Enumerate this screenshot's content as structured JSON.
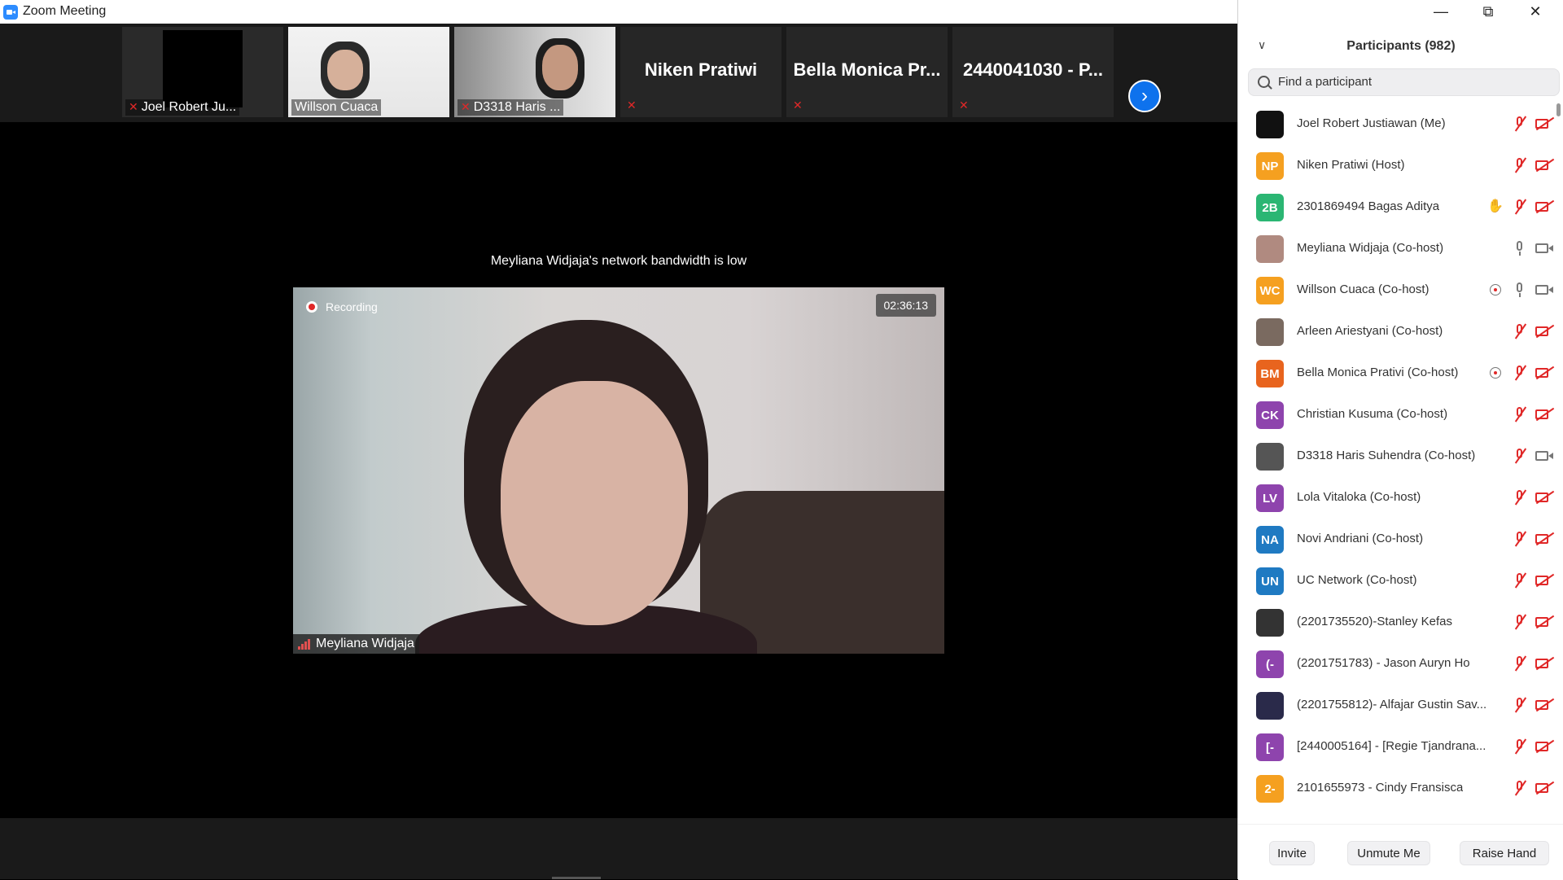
{
  "window": {
    "title": "Zoom Meeting"
  },
  "gallery": {
    "tiles": [
      {
        "name": "Joel Robert Ju...",
        "type": "video",
        "muted": true
      },
      {
        "name": "Willson Cuaca",
        "type": "video",
        "muted": false
      },
      {
        "name": "D3318 Haris ...",
        "type": "video",
        "muted": true
      },
      {
        "name": "Niken Pratiwi",
        "type": "name-only",
        "muted": true
      },
      {
        "name": "Bella Monica Pr...",
        "type": "name-only",
        "muted": true
      },
      {
        "name": "2440041030 - P...",
        "type": "name-only",
        "muted": true
      }
    ],
    "next_icon": "chevron-right-icon"
  },
  "main": {
    "notice": "Meyliana Widjaja's network bandwidth is low",
    "recording_label": "Recording",
    "timer": "02:36:13",
    "speaker_name": "Meyliana Widjaja"
  },
  "participants": {
    "title": "Participants (982)",
    "search_placeholder": "Find a participant",
    "list": [
      {
        "name": "Joel Robert Justiawan (Me)",
        "initials": "",
        "color": "#111111",
        "icons": [
          "mic-off",
          "cam-off"
        ]
      },
      {
        "name": "Niken Pratiwi (Host)",
        "initials": "NP",
        "color": "#f5a020",
        "icons": [
          "mic-off",
          "cam-off"
        ]
      },
      {
        "name": "2301869494 Bagas Aditya",
        "initials": "2B",
        "color": "#2bb673",
        "icons": [
          "hand",
          "mic-off",
          "cam-off"
        ]
      },
      {
        "name": "Meyliana Widjaja (Co-host)",
        "initials": "",
        "color": "#b08a80",
        "icons": [
          "mic-on",
          "cam-on"
        ]
      },
      {
        "name": "Willson Cuaca (Co-host)",
        "initials": "WC",
        "color": "#f5a020",
        "icons": [
          "rec-on",
          "mic-on",
          "cam-on"
        ]
      },
      {
        "name": "Arleen Ariestyani (Co-host)",
        "initials": "",
        "color": "#7a6a60",
        "icons": [
          "mic-off",
          "cam-off"
        ]
      },
      {
        "name": "Bella Monica Prativi (Co-host)",
        "initials": "BM",
        "color": "#e8641e",
        "icons": [
          "rec-on",
          "mic-off",
          "cam-off"
        ]
      },
      {
        "name": "Christian Kusuma (Co-host)",
        "initials": "CK",
        "color": "#8e44ad",
        "icons": [
          "mic-off",
          "cam-off"
        ]
      },
      {
        "name": "D3318 Haris Suhendra (Co-host)",
        "initials": "",
        "color": "#555555",
        "icons": [
          "mic-off",
          "cam-on"
        ]
      },
      {
        "name": "Lola Vitaloka (Co-host)",
        "initials": "LV",
        "color": "#8e44ad",
        "icons": [
          "mic-off",
          "cam-off"
        ]
      },
      {
        "name": "Novi Andriani (Co-host)",
        "initials": "NA",
        "color": "#1f7ac2",
        "icons": [
          "mic-off",
          "cam-off"
        ]
      },
      {
        "name": "UC Network (Co-host)",
        "initials": "UN",
        "color": "#1f7ac2",
        "icons": [
          "mic-off",
          "cam-off"
        ]
      },
      {
        "name": "(2201735520)-Stanley Kefas",
        "initials": "",
        "color": "#333333",
        "icons": [
          "mic-off",
          "cam-off"
        ]
      },
      {
        "name": "(2201751783) - Jason Auryn Ho",
        "initials": "(-",
        "color": "#8e44ad",
        "icons": [
          "mic-off",
          "cam-off"
        ]
      },
      {
        "name": "(2201755812)- Alfajar Gustin Sav...",
        "initials": "",
        "color": "#2a2a4a",
        "icons": [
          "mic-off",
          "cam-off"
        ]
      },
      {
        "name": "[2440005164] - [Regie Tjandrana...",
        "initials": "[-",
        "color": "#8e44ad",
        "icons": [
          "mic-off",
          "cam-off"
        ]
      },
      {
        "name": "2101655973 - Cindy Fransisca",
        "initials": "2-",
        "color": "#f5a020",
        "icons": [
          "mic-off",
          "cam-off"
        ]
      }
    ],
    "buttons": {
      "invite": "Invite",
      "unmute": "Unmute Me",
      "raise_hand": "Raise Hand"
    }
  }
}
